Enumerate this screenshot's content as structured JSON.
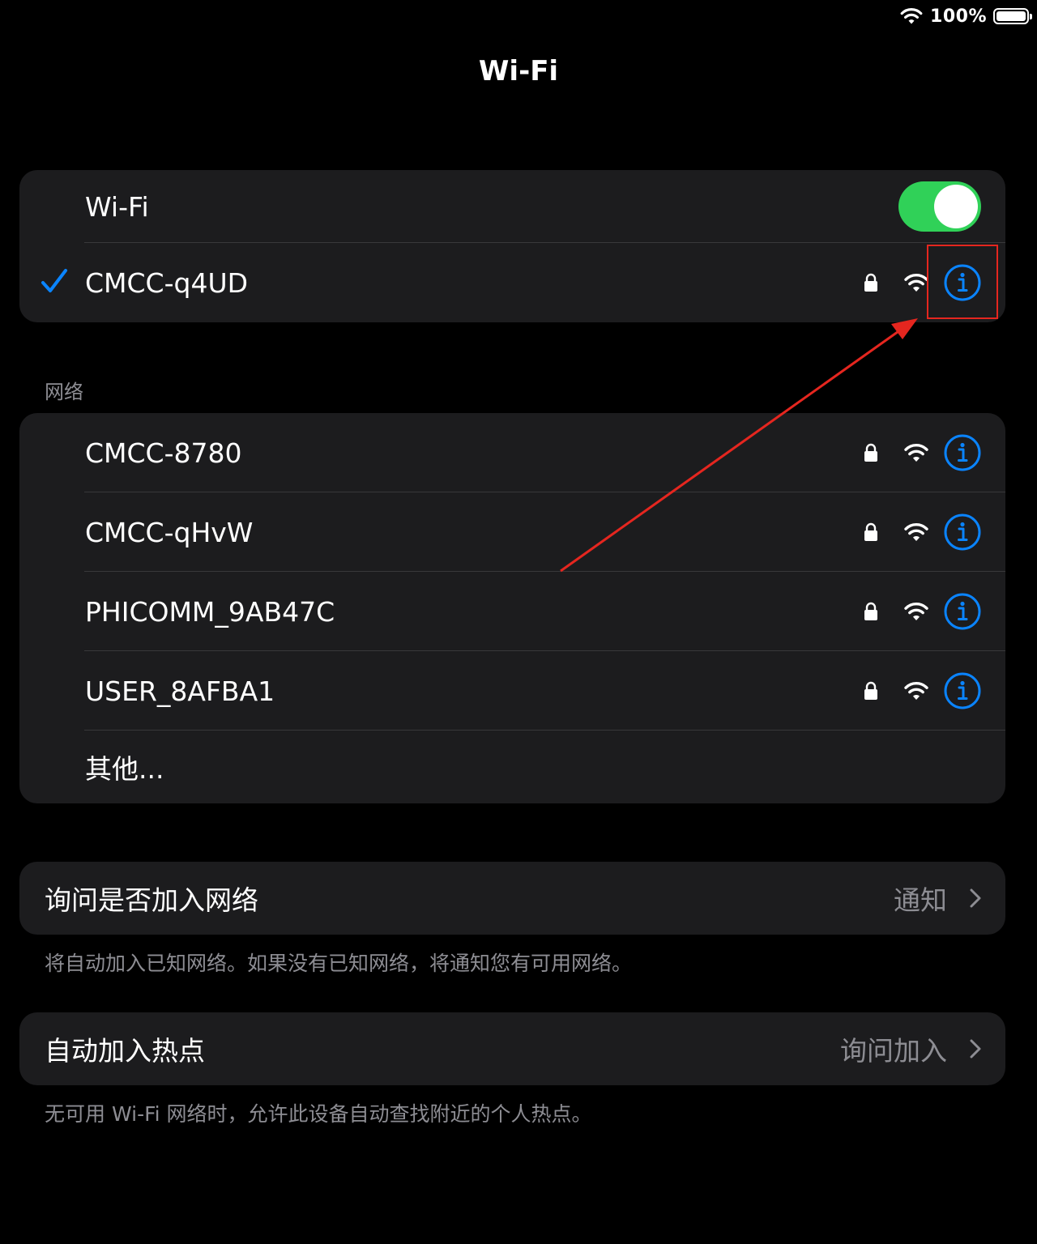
{
  "status_bar": {
    "battery_percent": "100%",
    "battery_level": 1.0
  },
  "title": "Wi-Fi",
  "wifi_card": {
    "wifi_label": "Wi-Fi",
    "wifi_enabled": true,
    "connected_network": "CMCC-q4UD"
  },
  "networks_header": "网络",
  "networks": [
    {
      "name": "CMCC-8780",
      "secured": true
    },
    {
      "name": "CMCC-qHvW",
      "secured": true
    },
    {
      "name": "PHICOMM_9AB47C",
      "secured": true
    },
    {
      "name": "USER_8AFBA1",
      "secured": true
    }
  ],
  "other_label": "其他...",
  "ask_to_join": {
    "label": "询问是否加入网络",
    "value": "通知",
    "footnote": "将自动加入已知网络。如果没有已知网络，将通知您有可用网络。"
  },
  "auto_hotspot": {
    "label": "自动加入热点",
    "value": "询问加入",
    "footnote": "无可用 Wi-Fi 网络时，允许此设备自动查找附近的个人热点。"
  },
  "colors": {
    "accent": "#0a84ff",
    "toggle_on": "#30d158",
    "card_bg": "#1c1c1e",
    "secondary_text": "#8d8d93",
    "annotation": "#e5261f"
  }
}
